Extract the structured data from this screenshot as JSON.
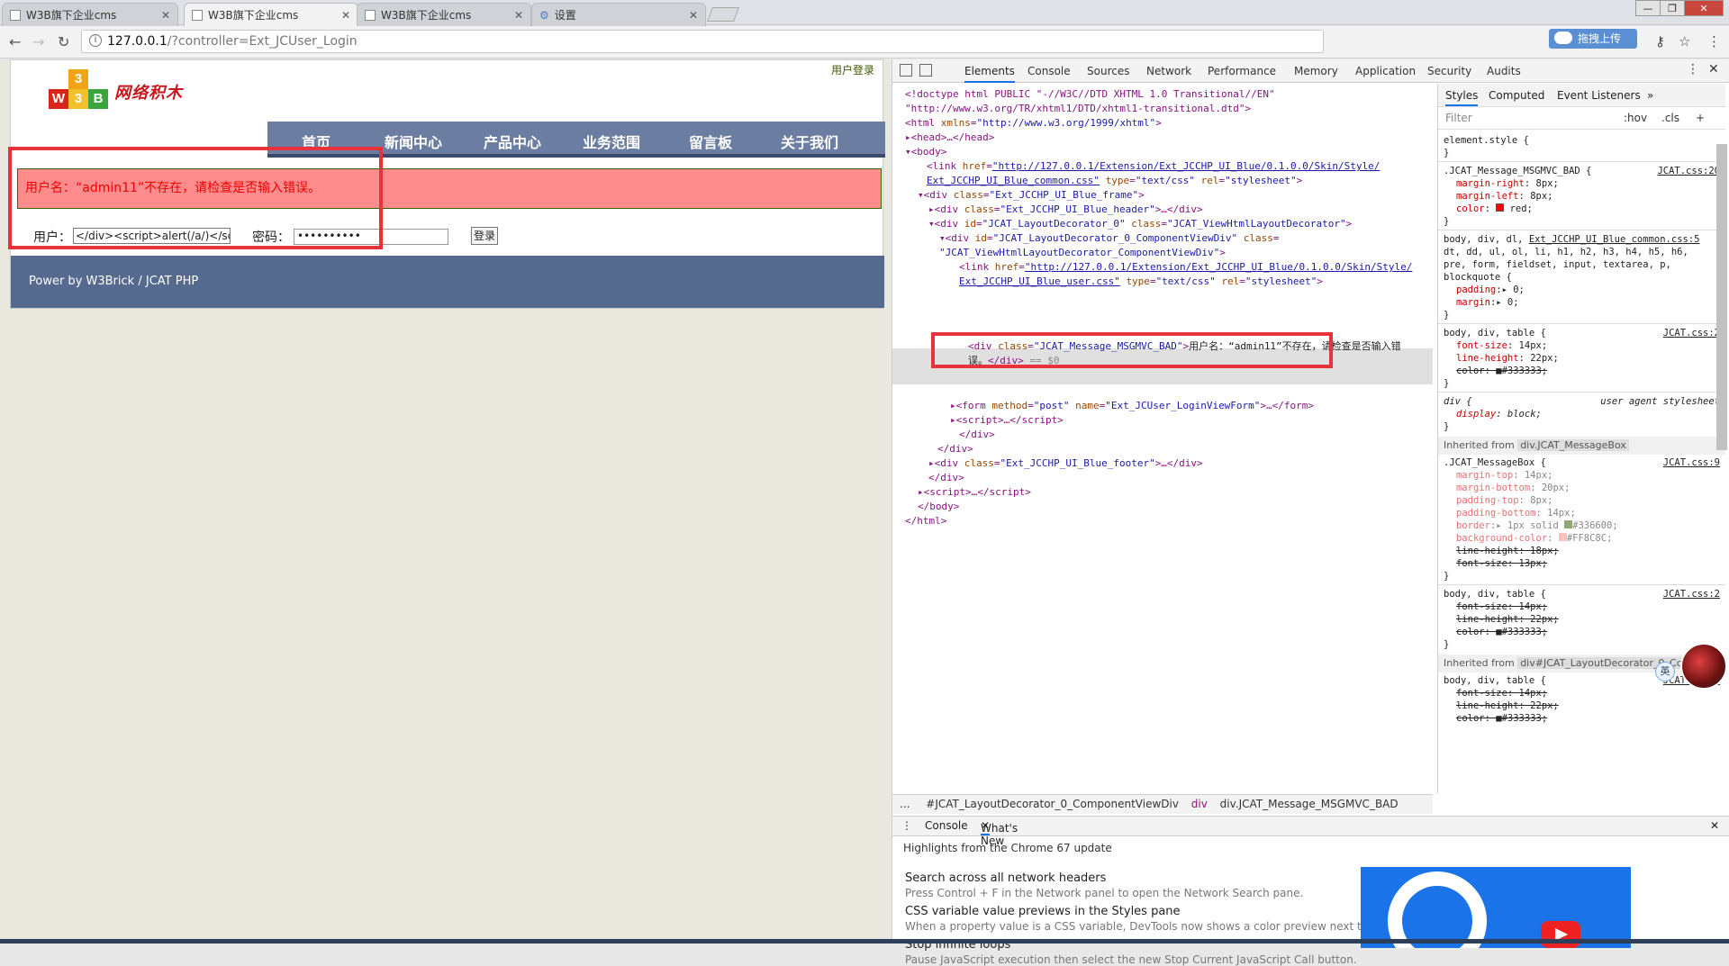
{
  "tabs": [
    {
      "title": "W3B旗下企业cms",
      "active": false
    },
    {
      "title": "W3B旗下企业cms",
      "active": true
    },
    {
      "title": "W3B旗下企业cms",
      "active": false
    },
    {
      "title": "设置",
      "active": false
    }
  ],
  "address": {
    "host": "127.0.0.1",
    "path": "/?controller=Ext_JCUser_Login"
  },
  "upload_label": "拖拽上传",
  "site": {
    "logo_text": "网络积木",
    "user_login": "用户登录",
    "nav": [
      "首页",
      "新闻中心",
      "产品中心",
      "业务范围",
      "留言板",
      "关于我们"
    ],
    "error_message": "用户名：“admin11”不存在，请检查是否输入错误。",
    "user_label": "用户：",
    "user_value": "</div><script>alert(/a/)</scrip",
    "password_label": "密码：",
    "password_value": "••••••••••",
    "login_button": "登录",
    "footer_prefix": "Power by ",
    "footer_link1": "W3Brick",
    "footer_sep": " / ",
    "footer_link2": "JCAT PHP"
  },
  "devtools": {
    "tabs": [
      "Elements",
      "Console",
      "Sources",
      "Network",
      "Performance",
      "Memory",
      "Application",
      "Security",
      "Audits"
    ],
    "style_tabs": [
      "Styles",
      "Computed",
      "Event Listeners"
    ],
    "filter_placeholder": "Filter",
    "hov": ":hov",
    "cls": ".cls",
    "breadcrumb": [
      "...",
      "#JCAT_LayoutDecorator_0_ComponentViewDiv",
      "div",
      "div.JCAT_Message_MSGMVC_BAD"
    ],
    "drawer_tabs": [
      "Console",
      "What's New"
    ],
    "highlights": "Highlights from the Chrome 67 update",
    "features": [
      {
        "title": "Search across all network headers",
        "desc": "Press Control + F in the Network panel to open the Network Search pane."
      },
      {
        "title": "CSS variable value previews in the Styles pane",
        "desc": "When a property value is a CSS variable, DevTools now shows a color preview next to the variable."
      },
      {
        "title": "Stop infinite loops",
        "desc": "Pause JavaScript execution then select the new Stop Current JavaScript Call button."
      }
    ],
    "ime": "英"
  }
}
